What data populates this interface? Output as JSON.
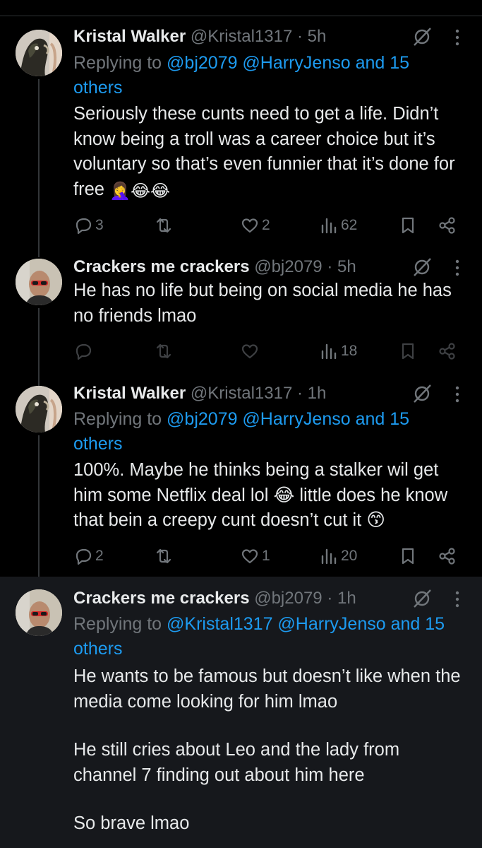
{
  "tweets": [
    {
      "name": "Kristal Walker",
      "handle": "@Kristal1317",
      "time": "· 5h",
      "replying_prefix": "Replying to",
      "replying_users": "@bj2079 @HarryJenso and 15 others",
      "body": [
        "Seriously these cunts need to get a life. Didn’t know being a troll was a career choice but it’s voluntary so that’s even funnier that it’s done for free"
      ],
      "emojis": [
        "🤦‍♀️",
        "😂",
        "😂"
      ],
      "counts": {
        "replies": "3",
        "reposts": "",
        "likes": "2",
        "views": "62"
      },
      "avatar": "parrot-avatar"
    },
    {
      "name": "Crackers me crackers",
      "handle": "@bj2079",
      "time": "· 5h",
      "replying_prefix": "",
      "replying_users": "",
      "body": [
        "He has no life but being on social media he has no friends lmao"
      ],
      "emojis": [],
      "counts": {
        "replies": "",
        "reposts": "",
        "likes": "",
        "views": "18"
      },
      "avatar": "man-avatar"
    },
    {
      "name": "Kristal Walker",
      "handle": "@Kristal1317",
      "time": "· 1h",
      "replying_prefix": "Replying to",
      "replying_users": "@bj2079 @HarryJenso and 15 others",
      "body": [
        "100%. Maybe he thinks being a stalker wil get him some Netflix deal lol 😂 little does he know that bein a creepy cunt doesn’t cut it 😙"
      ],
      "emojis": [],
      "counts": {
        "replies": "2",
        "reposts": "",
        "likes": "1",
        "views": "20"
      },
      "avatar": "parrot-avatar"
    },
    {
      "name": "Crackers me crackers",
      "handle": "@bj2079",
      "time": "· 1h",
      "replying_prefix": "Replying to",
      "replying_users": "@Kristal1317 @HarryJenso and 15 others",
      "body": [
        "He wants to be famous but doesn’t like when the media come looking for him lmao",
        "He still cries about Leo and the lady from channel 7 finding out about him here",
        "So brave lmao"
      ],
      "emojis": [],
      "counts": {},
      "avatar": "man-avatar"
    }
  ],
  "colors": {
    "background": "#000000",
    "highlight": "#16181c",
    "text": "#e7e9ea",
    "muted": "#71767b",
    "link": "#1d9bf0"
  }
}
